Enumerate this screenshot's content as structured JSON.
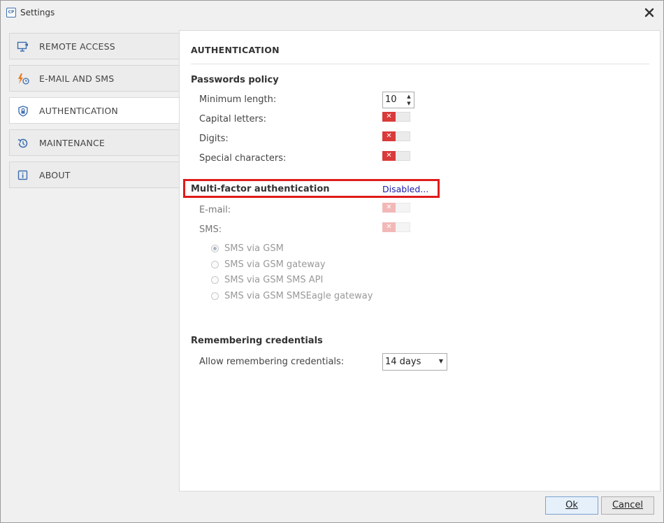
{
  "window": {
    "title": "Settings",
    "app_icon_text": "CP"
  },
  "sidebar": {
    "items": [
      {
        "label": "REMOTE ACCESS",
        "icon": "monitor-remote-icon",
        "active": false
      },
      {
        "label": "E-MAIL AND SMS",
        "icon": "bolt-clock-icon",
        "active": false
      },
      {
        "label": "AUTHENTICATION",
        "icon": "shield-lock-icon",
        "active": true
      },
      {
        "label": "MAINTENANCE",
        "icon": "history-icon",
        "active": false
      },
      {
        "label": "ABOUT",
        "icon": "info-icon",
        "active": false
      }
    ]
  },
  "main": {
    "title": "AUTHENTICATION",
    "passwords_policy": {
      "heading": "Passwords policy",
      "min_length_label": "Minimum length:",
      "min_length_value": "10",
      "capital_letters_label": "Capital letters:",
      "digits_label": "Digits:",
      "special_characters_label": "Special characters:"
    },
    "mfa": {
      "heading": "Multi-factor authentication",
      "status_link": "Disabled...",
      "email_label": "E-mail:",
      "sms_label": "SMS:",
      "sms_options": [
        "SMS via GSM",
        "SMS via GSM gateway",
        "SMS via GSM SMS API",
        "SMS via GSM SMSEagle gateway"
      ]
    },
    "remembering": {
      "heading": "Remembering credentials",
      "allow_label": "Allow remembering credentials:",
      "allow_value": "14 days"
    }
  },
  "footer": {
    "ok_label": "Ok",
    "cancel_label": "Cancel"
  },
  "colors": {
    "toggle_off": "#d93a3a",
    "toggle_off_disabled": "#f2b8b8",
    "highlight_box": "#e01b1b",
    "link": "#1a1aa8",
    "icon_blue": "#3d6fb0"
  }
}
